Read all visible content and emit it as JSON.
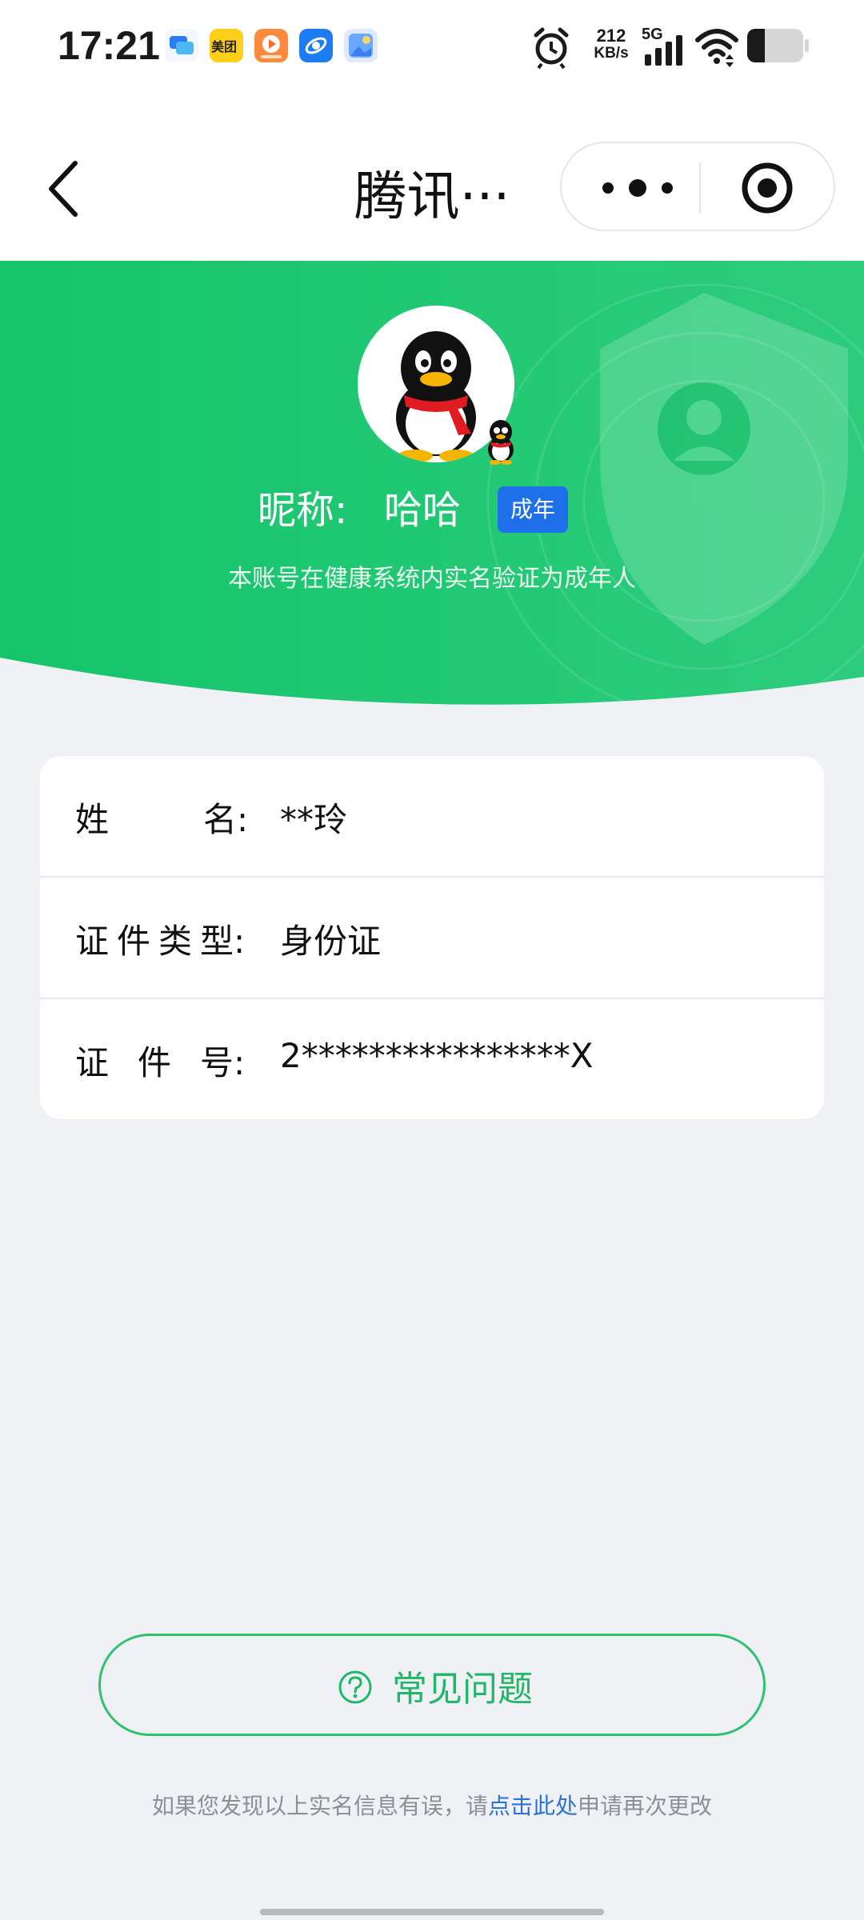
{
  "status_bar": {
    "time": "17:21",
    "net_speed_value": "212",
    "net_speed_unit": "KB/s",
    "network_type": "5G",
    "app_icons": [
      "chat-app-icon",
      "meituan-icon",
      "video-app-icon",
      "browser-app-icon",
      "gallery-app-icon"
    ],
    "meituan_text": "美团"
  },
  "title_bar": {
    "title": "腾讯···"
  },
  "header": {
    "nickname_label": "昵称:",
    "nickname": "哈哈",
    "adult_badge": "成年",
    "description": "本账号在健康系统内实名验证为成年人",
    "accent_color": "#1dc770"
  },
  "info": {
    "rows": [
      {
        "label_chars": [
          "姓",
          "名:"
        ],
        "value": "**玲"
      },
      {
        "label_chars": [
          "证",
          "件",
          "类",
          "型:"
        ],
        "value": "身份证"
      },
      {
        "label_chars": [
          "证",
          "件",
          "号:"
        ],
        "value": "2****************X"
      }
    ]
  },
  "faq": {
    "label": "常见问题"
  },
  "footer": {
    "prefix": "如果您发现以上实名信息有误，请",
    "link": "点击此处",
    "suffix": "申请再次更改"
  }
}
